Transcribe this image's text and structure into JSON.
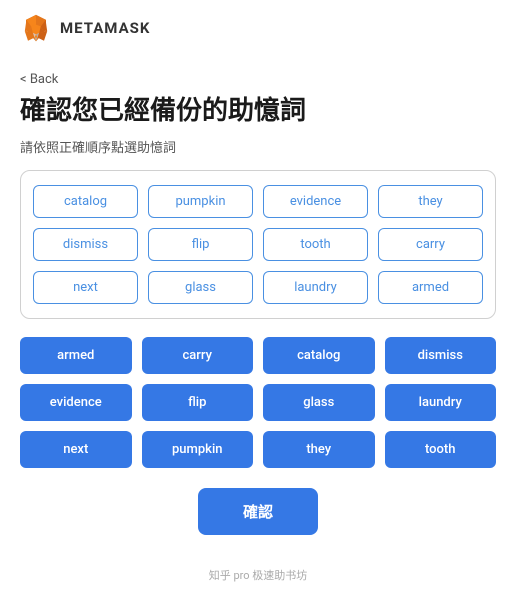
{
  "header": {
    "logo_alt": "MetaMask Fox",
    "app_name": "METAMASK"
  },
  "back": {
    "label": "< Back"
  },
  "page": {
    "title": "確認您已經備份的助憶詞",
    "subtitle": "請依照正確順序點選助憶詞"
  },
  "word_grid": {
    "words": [
      "catalog",
      "pumpkin",
      "evidence",
      "they",
      "dismiss",
      "flip",
      "tooth",
      "carry",
      "next",
      "glass",
      "laundry",
      "armed"
    ]
  },
  "selected_grid": {
    "words": [
      "armed",
      "carry",
      "catalog",
      "dismiss",
      "evidence",
      "flip",
      "glass",
      "laundry",
      "next",
      "pumpkin",
      "they",
      "tooth"
    ]
  },
  "confirm_button": {
    "label": "確認"
  },
  "footer": {
    "watermark": "知乎 pro 极速助书坊"
  }
}
